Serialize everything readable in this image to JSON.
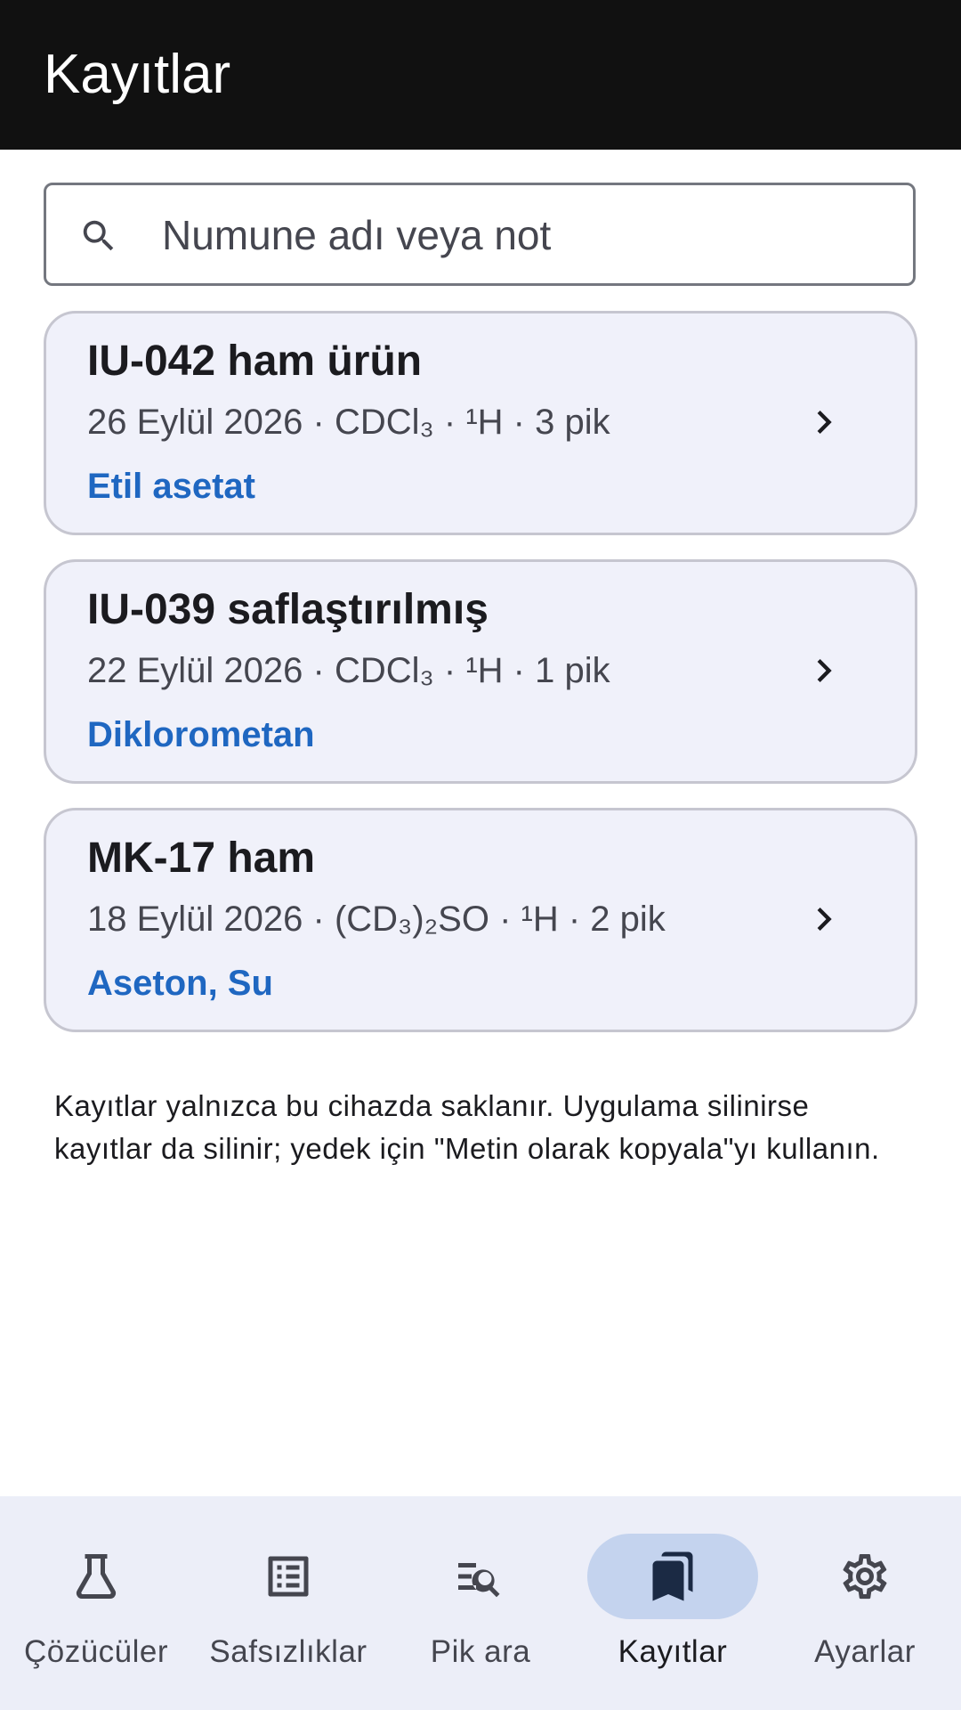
{
  "header": {
    "title": "Kayıtlar"
  },
  "search": {
    "placeholder": "Numune adı veya not",
    "value": "",
    "icon": "search-icon"
  },
  "records": [
    {
      "title": "IU-042 ham ürün",
      "meta": "26 Eylül 2026 · CDCl₃ · ¹H · 3 pik",
      "tag": "Etil asetat"
    },
    {
      "title": "IU-039 saflaştırılmış",
      "meta": "22 Eylül 2026 · CDCl₃ · ¹H · 1 pik",
      "tag": "Diklorometan"
    },
    {
      "title": "MK-17 ham",
      "meta": "18 Eylül 2026 · (CD₃)₂SO · ¹H · 2 pik",
      "tag": "Aseton, Su"
    }
  ],
  "notice": "Kayıtlar yalnızca bu cihazda saklanır. Uygulama silinirse kayıtlar da silinir; yedek için \"Metin olarak kopyala\"yı kullanın.",
  "nav": {
    "items": [
      {
        "label": "Çözücüler",
        "icon": "flask-icon",
        "active": false
      },
      {
        "label": "Safsızlıklar",
        "icon": "list-icon",
        "active": false
      },
      {
        "label": "Pik ara",
        "icon": "peak-search-icon",
        "active": false
      },
      {
        "label": "Kayıtlar",
        "icon": "bookmarks-icon",
        "active": true
      },
      {
        "label": "Ayarlar",
        "icon": "gear-icon",
        "active": false
      }
    ]
  },
  "colors": {
    "topbar": "#111111",
    "card_background": "#f0f1fa",
    "tag": "#1f67c1",
    "nav_background": "#eceef8",
    "nav_active_pill": "#c4d3ee"
  }
}
